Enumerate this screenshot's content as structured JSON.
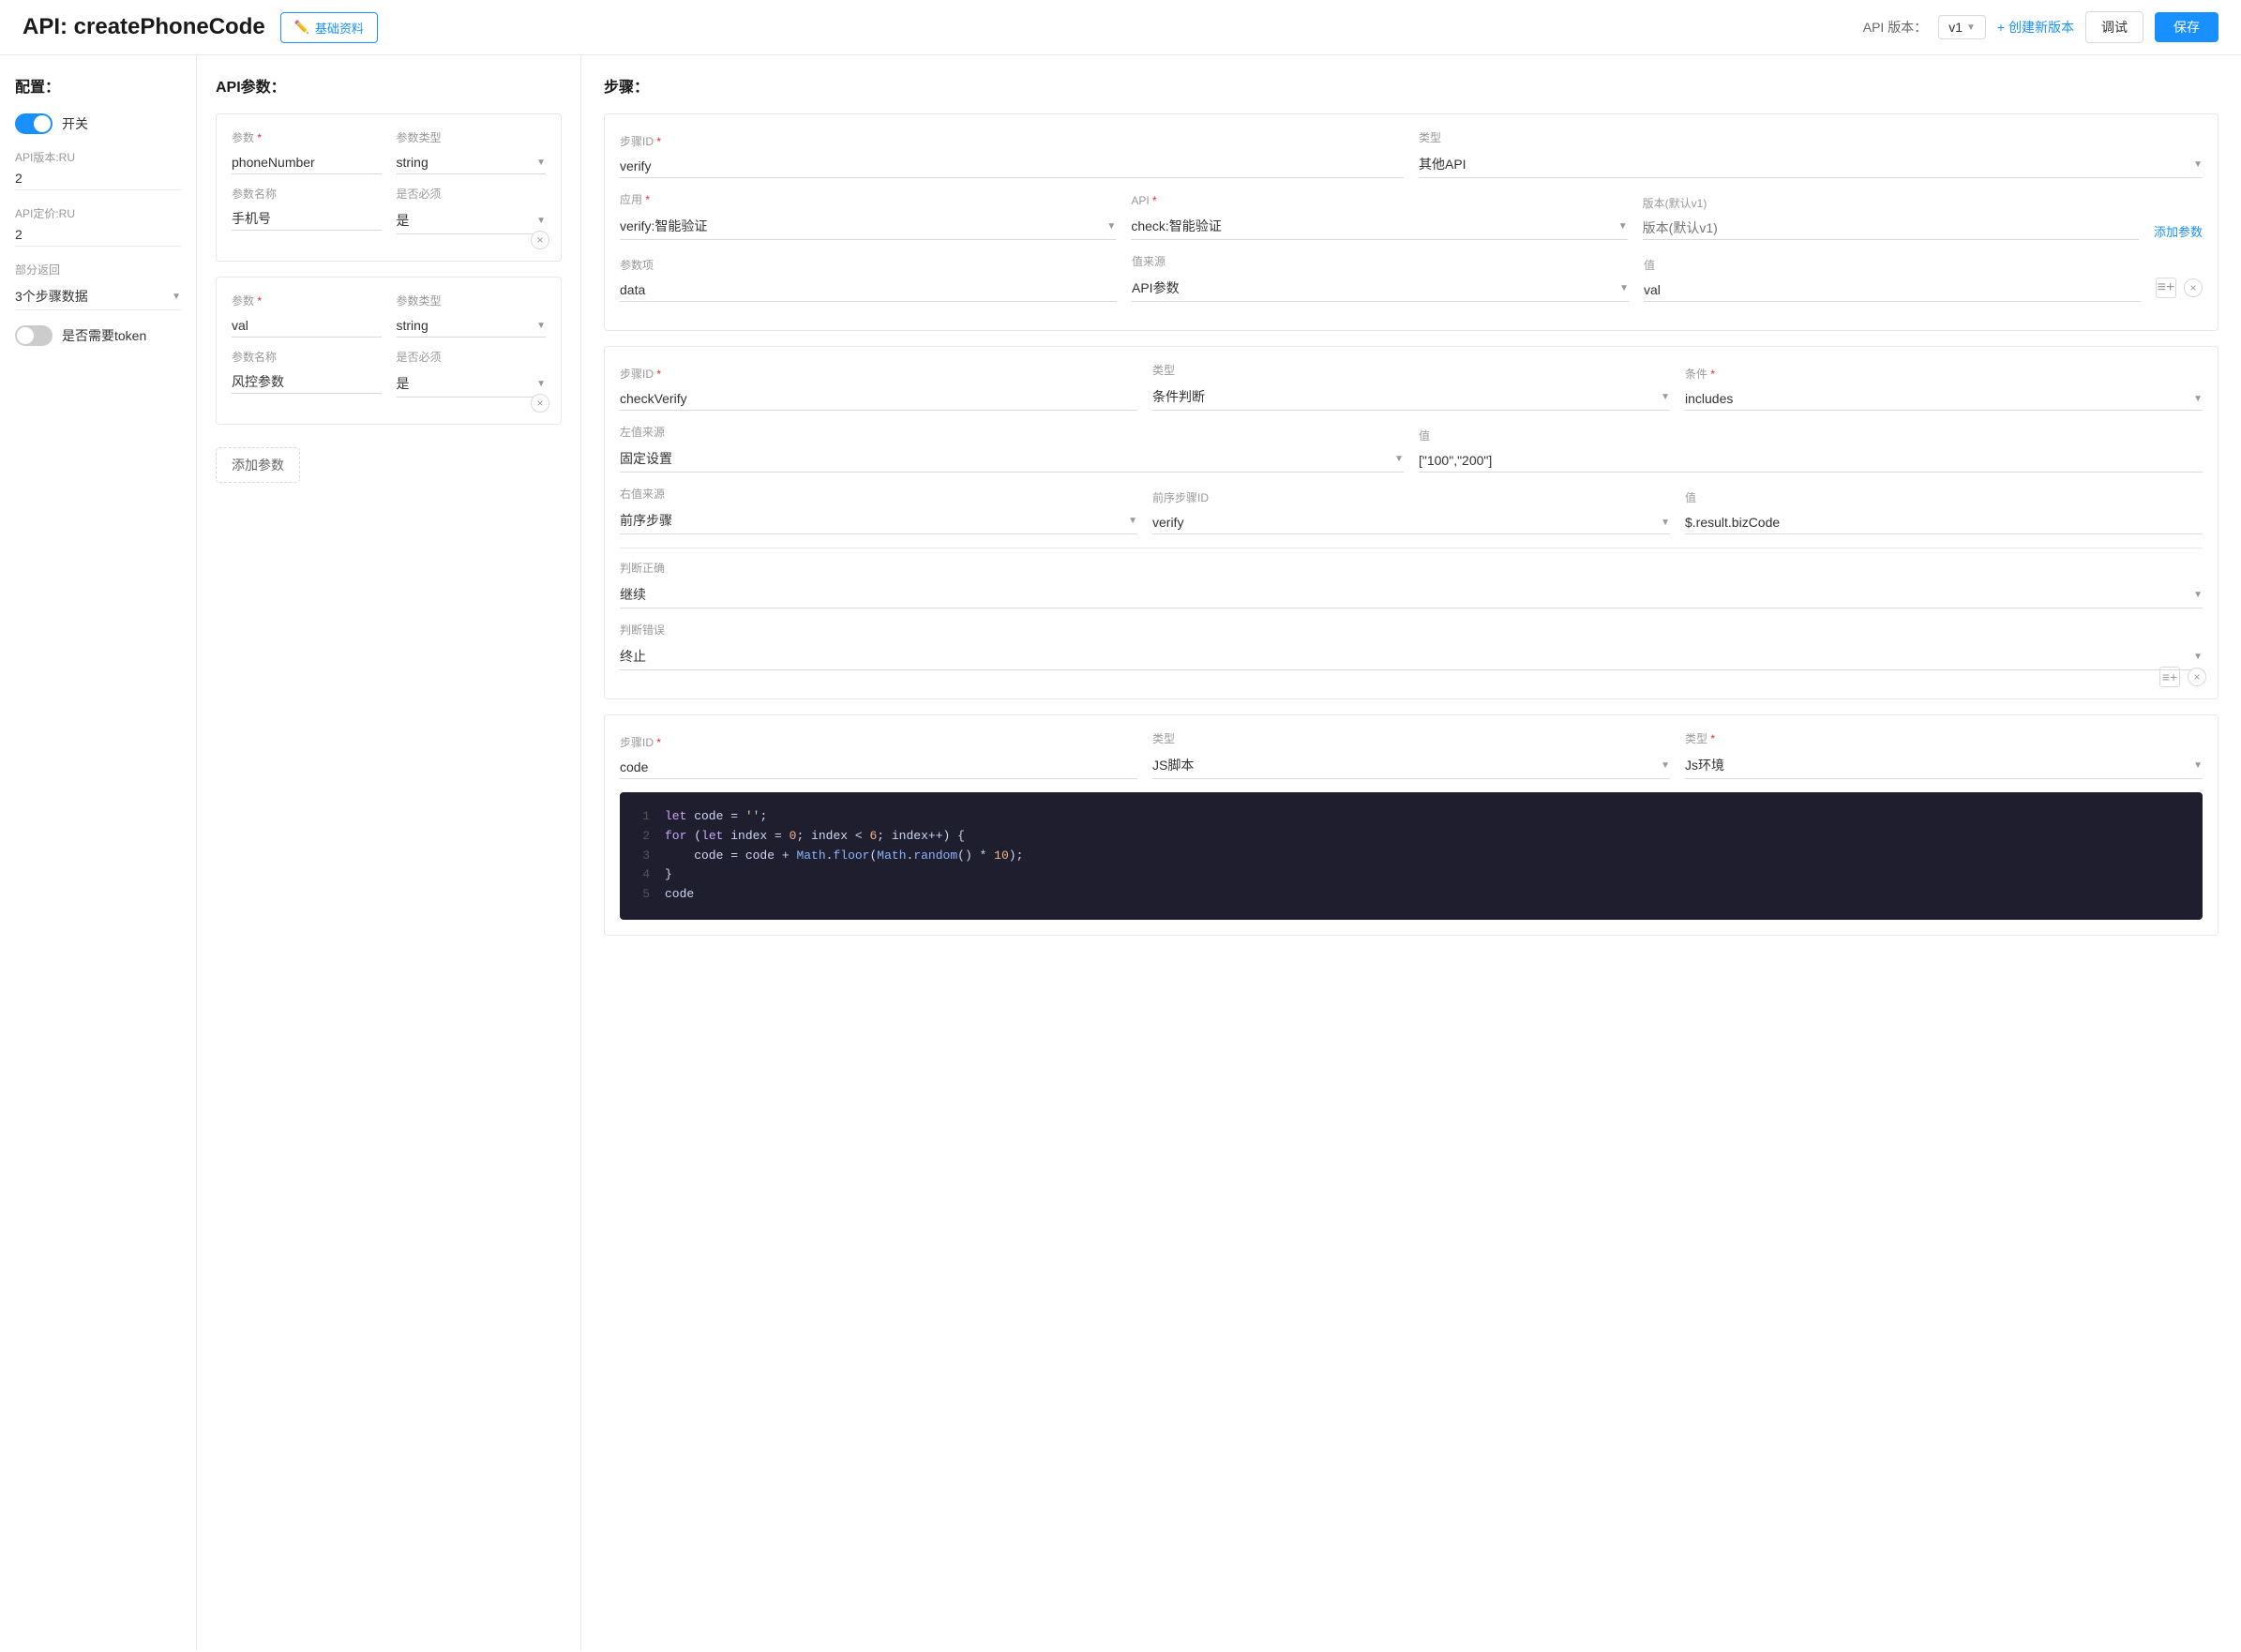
{
  "header": {
    "title": "API: createPhoneCode",
    "basic_info_btn": "基础资料",
    "api_version_label": "API 版本：",
    "version": "v1",
    "create_version_btn": "+ 创建新版本",
    "debug_btn": "调试",
    "save_btn": "保存"
  },
  "config": {
    "section_title": "配置：",
    "toggle_label": "开关",
    "api_version_label": "API版本:RU",
    "api_version_value": "2",
    "api_price_label": "API定价:RU",
    "api_price_value": "2",
    "partial_return_label": "部分返回",
    "partial_return_value": "3个步骤数据",
    "token_label": "是否需要token"
  },
  "params": {
    "section_title": "API参数：",
    "param1": {
      "param_label": "参数",
      "param_required": "*",
      "param_value": "phoneNumber",
      "type_label": "参数类型",
      "type_value": "string",
      "name_label": "参数名称",
      "name_value": "手机号",
      "required_label": "是否必须",
      "required_value": "是"
    },
    "param2": {
      "param_label": "参数",
      "param_required": "*",
      "param_value": "val",
      "type_label": "参数类型",
      "type_value": "string",
      "name_label": "参数名称",
      "name_value": "风控参数",
      "required_label": "是否必须",
      "required_value": "是"
    },
    "add_param_btn": "添加参数"
  },
  "steps": {
    "section_title": "步骤：",
    "step1": {
      "id_label": "步骤ID",
      "id_required": "*",
      "id_value": "verify",
      "type_label": "类型",
      "type_value": "其他API",
      "app_label": "应用",
      "app_required": "*",
      "app_value": "verify:智能验证",
      "api_label": "API",
      "api_required": "*",
      "api_value": "check:智能验证",
      "version_label": "版本(默认v1)",
      "version_value": "版本(默认v1)",
      "add_param_link": "添加参数",
      "param_label": "参数项",
      "param_value": "data",
      "source_label": "值来源",
      "source_value": "API参数",
      "value_label": "值",
      "value_value": "val"
    },
    "step2": {
      "id_label": "步骤ID",
      "id_required": "*",
      "id_value": "checkVerify",
      "type_label": "类型",
      "type_value": "条件判断",
      "condition_label": "条件",
      "condition_required": "*",
      "condition_value": "includes",
      "left_source_label": "左值来源",
      "left_source_value": "固定设置",
      "value_label": "值",
      "value_value": "[\"100\",\"200\"]",
      "right_source_label": "右值来源",
      "right_source_value": "前序步骤",
      "prev_step_label": "前序步骤ID",
      "prev_step_value": "verify",
      "right_value_label": "值",
      "right_value_value": "$.result.bizCode",
      "judge_ok_label": "判断正确",
      "judge_ok_value": "继续",
      "judge_err_label": "判断错误",
      "judge_err_value": "终止"
    },
    "step3": {
      "id_label": "步骤ID",
      "id_required": "*",
      "id_value": "code",
      "type_label": "类型",
      "type_value": "JS脚本",
      "type2_label": "类型",
      "type2_required": "*",
      "type2_value": "Js环境",
      "code_lines": [
        {
          "num": "1",
          "text": "let code = '';"
        },
        {
          "num": "2",
          "text": "for (let index = 0; index < 6; index++) {"
        },
        {
          "num": "3",
          "text": "    code = code + Math.floor(Math.random() * 10);"
        },
        {
          "num": "4",
          "text": "}"
        },
        {
          "num": "5",
          "text": "code"
        }
      ]
    }
  }
}
